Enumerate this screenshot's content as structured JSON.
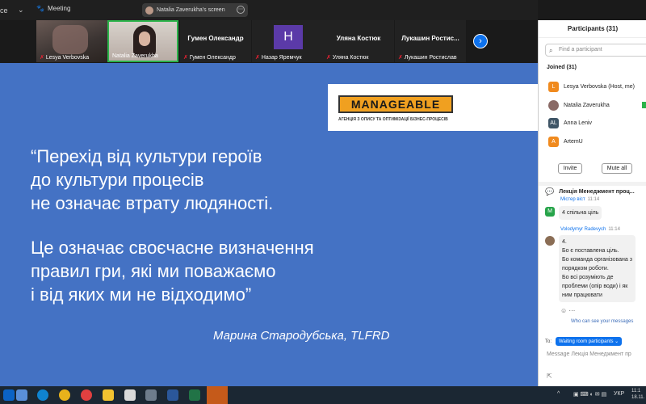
{
  "topbar": {
    "app_fragment": "ce",
    "meeting_label": "Meeting",
    "share_label": "Natalia Zaverukha's screen"
  },
  "video_strip": {
    "tiles": [
      {
        "name": "Lesya Verbovska",
        "muted": true
      },
      {
        "name": "Natalia Zaverukha",
        "muted": false
      },
      {
        "center_name": "Гумен Олександр",
        "name": "Гумен Олександр",
        "muted": true
      },
      {
        "avatar_letter": "H",
        "name": "Назар Яремчук",
        "muted": true
      },
      {
        "center_name": "Уляна Костюк",
        "name": "Уляна Костюк",
        "muted": true
      },
      {
        "center_name": "Лукашин Ростис...",
        "name": "Лукашин Ростислав",
        "muted": true
      }
    ],
    "next_icon": "chevron-right-icon"
  },
  "slide": {
    "logo_text": "MANAGEABLE",
    "logo_sub": "АГЕНЦІЯ З ОПИСУ ТА ОПТИМІЗАЦІЇ БІЗНЕС-ПРОЦЕСІВ",
    "quote1": [
      "“Перехід від культури героїв",
      "до культури процесів",
      "не означає втрату людяності."
    ],
    "quote2": [
      "Це означає своєчасне визначення",
      "правил гри, які ми поважаємо",
      "і від яких ми не відходимо”"
    ],
    "author": "Марина Стародубська, TLFRD"
  },
  "participants": {
    "title": "Participants (31)",
    "search_placeholder": "Find a participant",
    "joined_label": "Joined (31)",
    "list": [
      {
        "initial": "L",
        "name": "Lesya Verbovska (Host, me)",
        "avatar": "orange"
      },
      {
        "initial": "",
        "name": "Natalia Zaverukha",
        "avatar": "photo"
      },
      {
        "initial": "AL",
        "name": "Anna Leniv",
        "avatar": "slate"
      },
      {
        "initial": "A",
        "name": "ArtemU",
        "avatar": "orange"
      }
    ],
    "invite_label": "Invite",
    "mute_all_label": "Mute all"
  },
  "chat": {
    "title": "Лекція Менеджмент проц...",
    "messages": [
      {
        "sender": "Містер віст",
        "time": "11:14",
        "lines": [
          "4 спільна ціль"
        ]
      },
      {
        "sender": "Volodymyr Radevych",
        "time": "11:14",
        "lines": [
          "4.",
          "Бо є поставлена ціль.",
          "Бо команда організована з",
          "порядком роботи.",
          "Бо всі розуміють де",
          "проблеми (опір води) і як",
          "ним працювати"
        ]
      }
    ],
    "who_can_see": "Who can see your messages",
    "to_label": "To:",
    "to_value": "Waiting room participants",
    "input_placeholder": "Message Лекція Менеджмент пр"
  },
  "taskbar": {
    "lang": "УКР",
    "time": "11:1",
    "date": "18.11."
  }
}
